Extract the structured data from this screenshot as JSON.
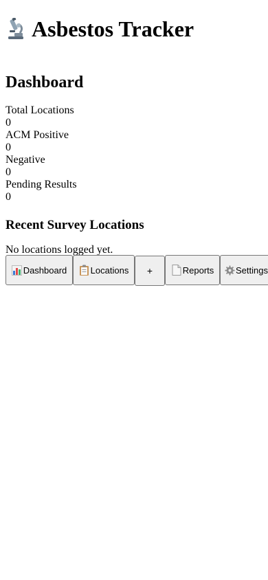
{
  "header": {
    "title_icon": "microscope-icon",
    "title": "Asbestos Tracker"
  },
  "page": {
    "title": "Dashboard"
  },
  "stats": [
    {
      "label": "Total Locations",
      "value": "0"
    },
    {
      "label": "ACM Positive",
      "value": "0"
    },
    {
      "label": "Negative",
      "value": "0"
    },
    {
      "label": "Pending Results",
      "value": "0"
    }
  ],
  "recent": {
    "title": "Recent Survey Locations",
    "empty": "No locations logged yet."
  },
  "nav": {
    "dashboard": {
      "icon": "bar-chart-icon",
      "label": "Dashboard"
    },
    "locations": {
      "icon": "clipboard-icon",
      "label": "Locations"
    },
    "add": {
      "icon": "plus-icon",
      "label": "+"
    },
    "reports": {
      "icon": "document-icon",
      "label": "Reports"
    },
    "settings": {
      "icon": "gear-icon",
      "label": "Settings"
    }
  }
}
